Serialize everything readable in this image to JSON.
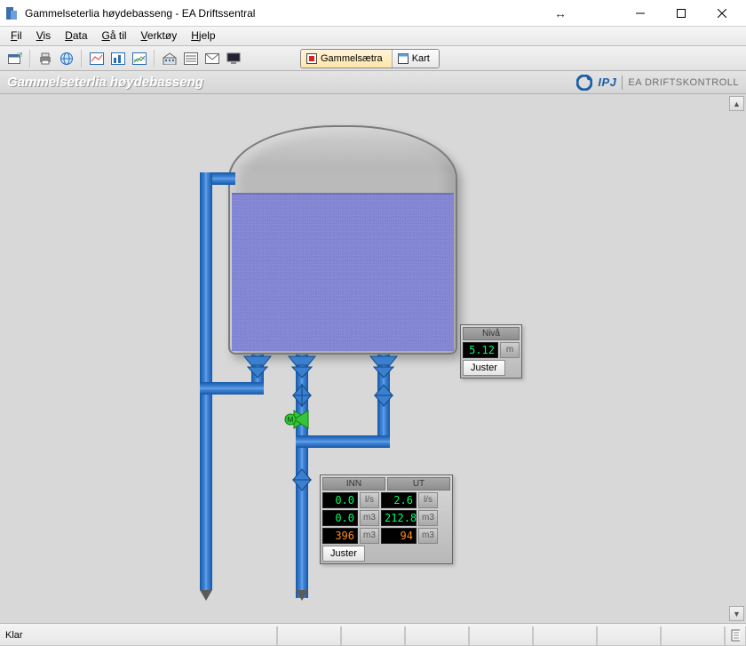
{
  "window": {
    "title": "Gammelseterlia høydebasseng - EA Driftssentral"
  },
  "menu": {
    "items": [
      "Fil",
      "Vis",
      "Data",
      "Gå til",
      "Verktøy",
      "Hjelp"
    ]
  },
  "tabs": {
    "main": "Gammelsætra",
    "map": "Kart"
  },
  "header": {
    "pagetitle": "Gammelseterlia høydebasseng",
    "brand_logo": "IPJ",
    "brand_text": "EA DRIFTSKONTROLL"
  },
  "level_gauge": {
    "head": "Nivå",
    "value": "5.12",
    "unit": "m",
    "adjust": "Juster"
  },
  "flow_gauge": {
    "head_in": "INN",
    "head_out": "UT",
    "in_ls": "0.0",
    "out_ls": "2.6",
    "unit_ls": "l/s",
    "in_m3": "0.0",
    "out_m3": "212.8",
    "unit_m3": "m3",
    "in_tot": "396",
    "out_tot": "94",
    "unit_tot": "m3",
    "adjust": "Juster"
  },
  "status": {
    "ready": "Klar"
  }
}
